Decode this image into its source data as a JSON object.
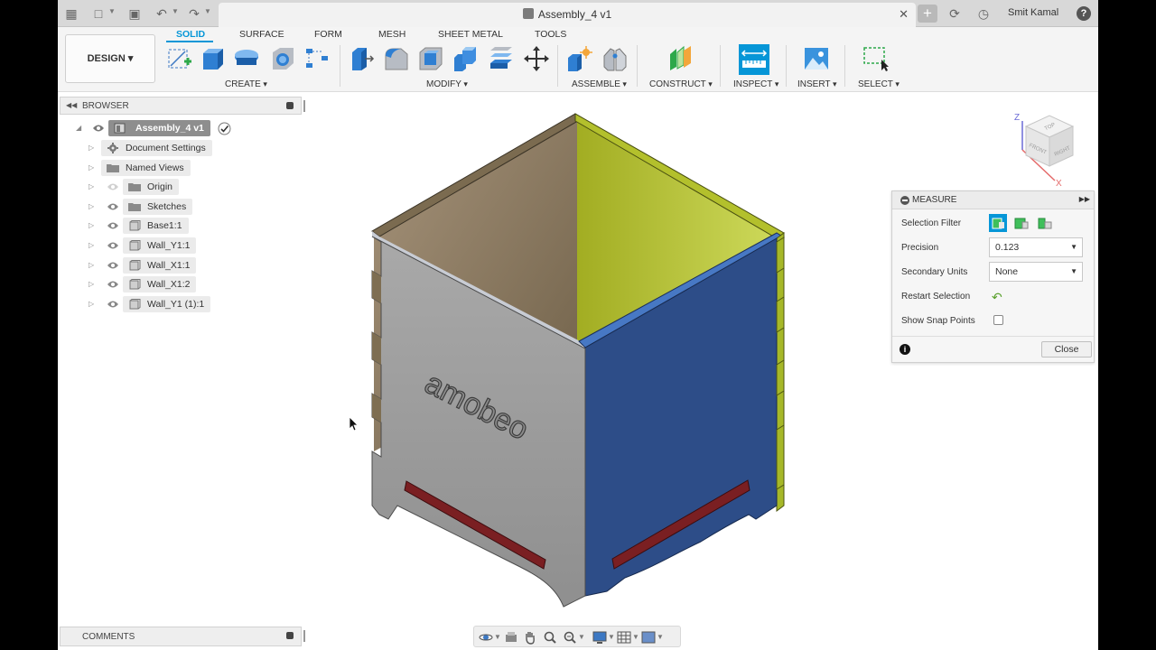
{
  "window": {
    "document_title": "Assembly_4 v1",
    "user_name": "Smit Kamal"
  },
  "toolbar": {
    "workspace_button": "DESIGN",
    "tabs": [
      "SOLID",
      "SURFACE",
      "FORM",
      "MESH",
      "SHEET METAL",
      "TOOLS"
    ],
    "active_tab": "SOLID",
    "groups": [
      "CREATE",
      "MODIFY",
      "ASSEMBLE",
      "CONSTRUCT",
      "INSPECT",
      "INSERT",
      "SELECT"
    ]
  },
  "browser": {
    "title": "BROWSER",
    "root": "Assembly_4 v1",
    "items": [
      {
        "label": "Document Settings",
        "icon": "gear-icon"
      },
      {
        "label": "Named Views",
        "icon": "folder-icon"
      },
      {
        "label": "Origin",
        "icon": "folder-icon"
      },
      {
        "label": "Sketches",
        "icon": "folder-icon"
      },
      {
        "label": "Base1:1",
        "icon": "body-icon"
      },
      {
        "label": "Wall_Y1:1",
        "icon": "body-icon"
      },
      {
        "label": "Wall_X1:1",
        "icon": "body-icon"
      },
      {
        "label": "Wall_X1:2",
        "icon": "body-icon"
      },
      {
        "label": "Wall_Y1 (1):1",
        "icon": "body-icon"
      }
    ]
  },
  "comments": {
    "title": "COMMENTS"
  },
  "measure": {
    "title": "MEASURE",
    "selection_filter_label": "Selection Filter",
    "precision_label": "Precision",
    "precision_value": "0.123",
    "secondary_units_label": "Secondary Units",
    "secondary_units_value": "None",
    "restart_selection_label": "Restart Selection",
    "show_snap_points_label": "Show Snap Points",
    "show_snap_points_checked": false,
    "close_label": "Close"
  },
  "viewcube": {
    "faces": [
      "TOP",
      "FRONT",
      "RIGHT"
    ],
    "axes": [
      "Z",
      "X"
    ]
  },
  "model": {
    "engraving": "amobeo"
  },
  "colors": {
    "accent": "#0696d7",
    "wall_front": "#9c9c9c",
    "wall_right": "#2f4f8f",
    "wall_yellow": "#a6b828",
    "wall_tan": "#8e7c60",
    "slot_red": "#7a1f22"
  }
}
